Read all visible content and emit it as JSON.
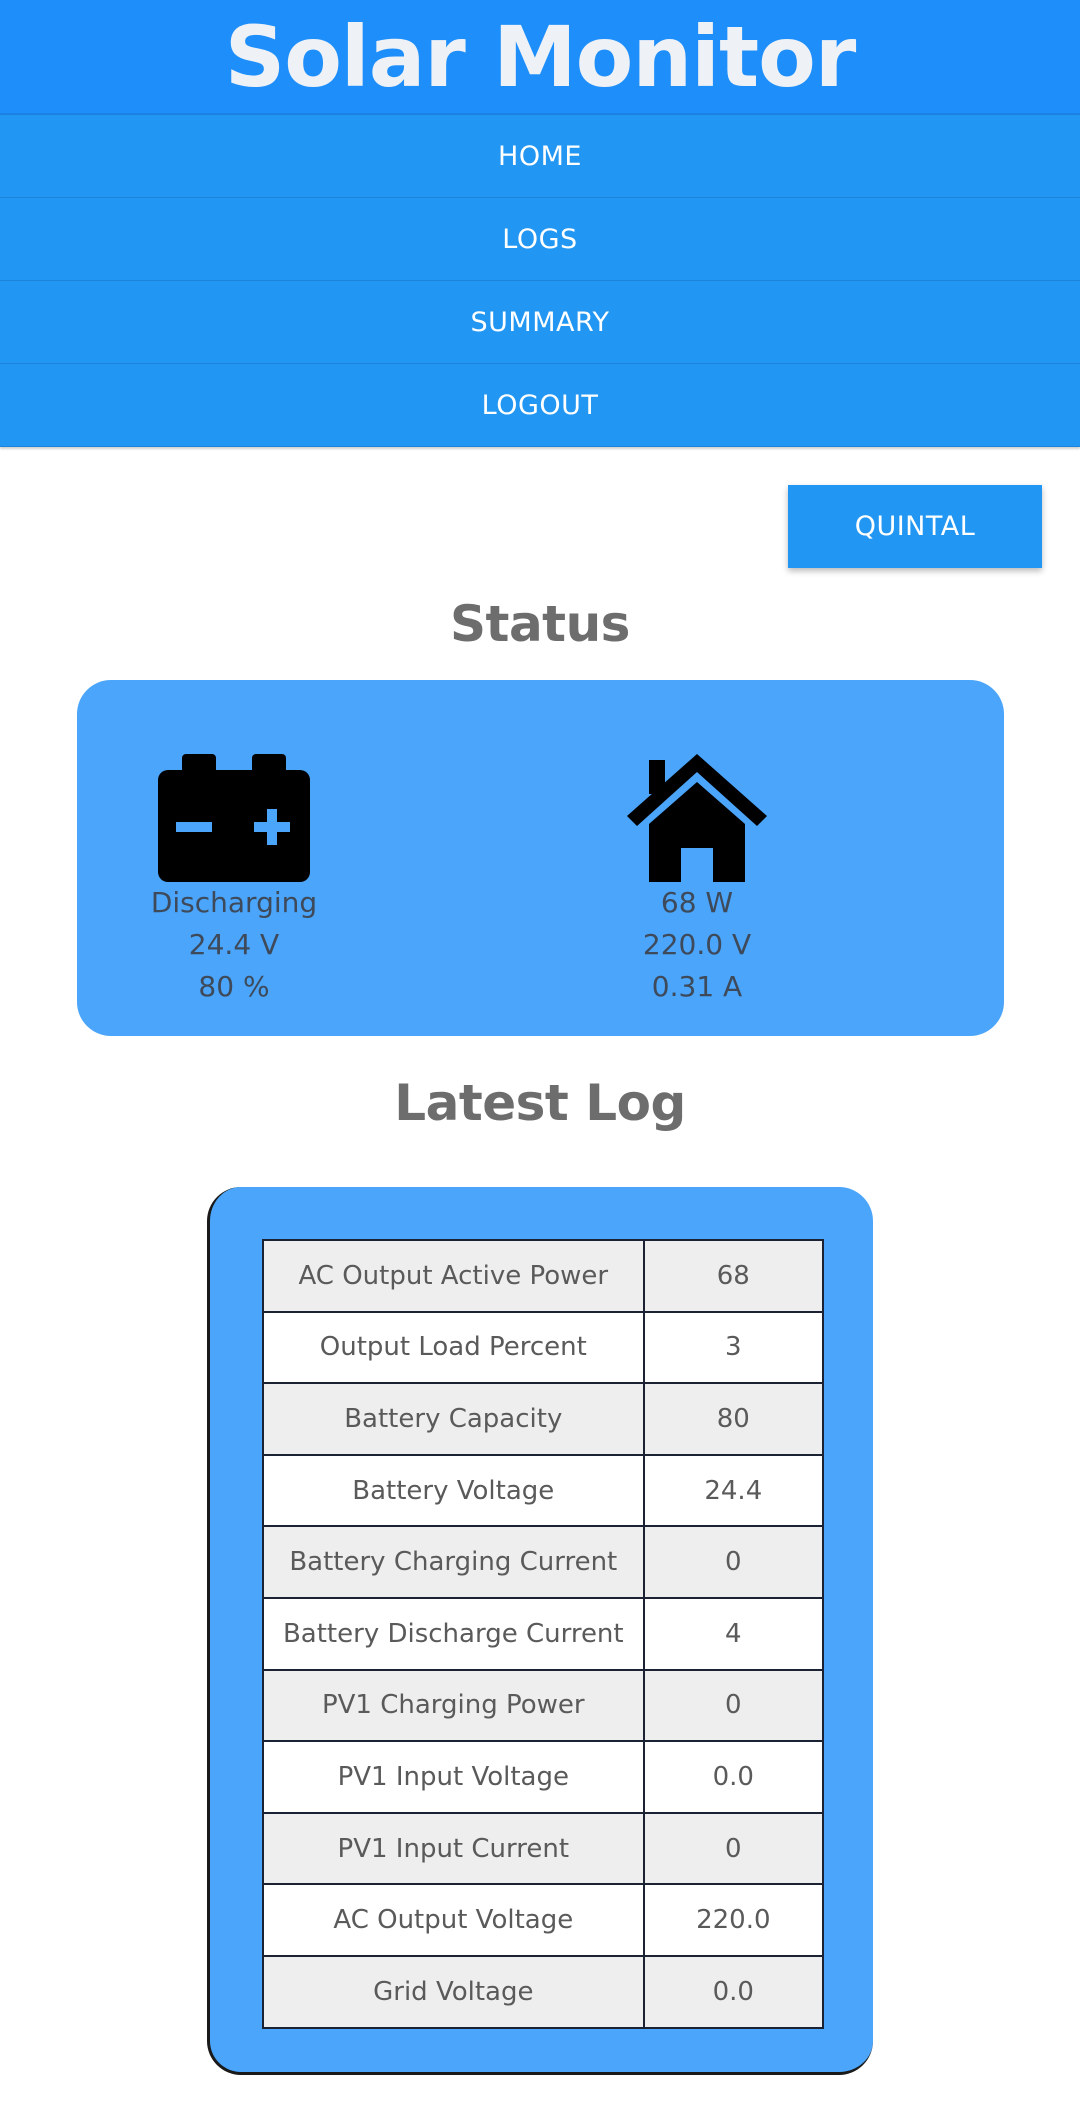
{
  "header": {
    "title": "Solar Monitor"
  },
  "nav": [
    {
      "label": "HOME"
    },
    {
      "label": "LOGS"
    },
    {
      "label": "SUMMARY"
    },
    {
      "label": "LOGOUT"
    }
  ],
  "location_button": {
    "label": "QUINTAL"
  },
  "status": {
    "title": "Status",
    "battery": {
      "icon": "battery-icon",
      "state": "Discharging",
      "voltage": "24.4 V",
      "percent": "80 %"
    },
    "home": {
      "icon": "house-icon",
      "power": "68 W",
      "voltage": "220.0 V",
      "current": "0.31 A"
    }
  },
  "latest_log": {
    "title": "Latest Log",
    "rows": [
      {
        "label": "AC Output Active Power",
        "value": "68"
      },
      {
        "label": "Output Load Percent",
        "value": "3"
      },
      {
        "label": "Battery Capacity",
        "value": "80"
      },
      {
        "label": "Battery Voltage",
        "value": "24.4"
      },
      {
        "label": "Battery Charging Current",
        "value": "0"
      },
      {
        "label": "Battery Discharge Current",
        "value": "4"
      },
      {
        "label": "PV1 Charging Power",
        "value": "0"
      },
      {
        "label": "PV1 Input Voltage",
        "value": "0.0"
      },
      {
        "label": "PV1 Input Current",
        "value": "0"
      },
      {
        "label": "AC Output Voltage",
        "value": "220.0"
      },
      {
        "label": "Grid Voltage",
        "value": "0.0"
      }
    ]
  },
  "colors": {
    "header": "#1e8ffa",
    "nav": "#2196f3",
    "card": "#4aa5fb"
  }
}
